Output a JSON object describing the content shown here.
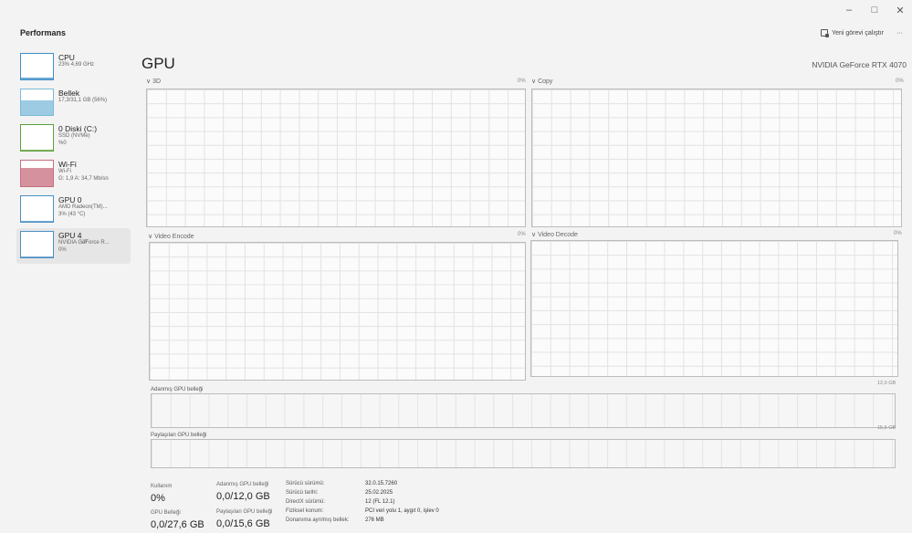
{
  "window": {
    "controls": [
      "–",
      "□",
      "✕"
    ]
  },
  "header": {
    "title": "Performans",
    "run_new_task": "Yeni görevi çalıştır",
    "more": "···"
  },
  "sidebar": {
    "items": [
      {
        "title": "CPU",
        "sub1": "23% 4,69 GHz",
        "sub2": "",
        "sub3": "",
        "color": "#3f8fc7",
        "fill_fraction": 0.06
      },
      {
        "title": "Bellek",
        "sub1": "17,3/31,1 GB (56%)",
        "sub2": "",
        "sub3": "",
        "color": "#7bbad9",
        "fill_fraction": 0.56
      },
      {
        "title": "0 Diski (C:)",
        "sub1": "SSD (NVMe)",
        "sub2": "%0",
        "sub3": "",
        "color": "#5d9e3a",
        "fill_fraction": 0.0
      },
      {
        "title": "Wi-Fi",
        "sub1": "Wi-Fi",
        "sub2": "G: 1,9 A: 34,7 Mb/sn",
        "sub3": "",
        "color": "#c76e7e",
        "fill_fraction": 0.7
      },
      {
        "title": "GPU 0",
        "sub1": "AMD Radeon(TM)...",
        "sub2": "3% (43 °C)",
        "sub3": "",
        "color": "#4a8fc2",
        "fill_fraction": 0.03
      },
      {
        "title": "GPU 4",
        "sub1": "NVIDIA GeForce R...",
        "sub2": "0%",
        "sub3": "",
        "color": "#4a8fc2",
        "fill_fraction": 0.0
      }
    ]
  },
  "main": {
    "title": "GPU",
    "model": "NVIDIA GeForce RTX 4070",
    "graphs": [
      {
        "label": "∨ 3D",
        "pct_left": "0%",
        "pct_right": ""
      },
      {
        "label": "∨ Copy",
        "pct_left": "",
        "pct_right": "0%"
      },
      {
        "label": "∨ Video Encode",
        "pct_left": "0%",
        "pct_right": ""
      },
      {
        "label": "∨ Video Decode",
        "pct_left": "",
        "pct_right": "0%"
      }
    ],
    "dedicated_memory": {
      "label": "Adanmış GPU belleği",
      "max": "12,0 GB"
    },
    "shared_memory": {
      "label": "Paylaşılan GPU belleği",
      "max": "15,6 GB"
    }
  },
  "stats": {
    "usage_label": "Kullanım",
    "usage_value": "0%",
    "dedicated_label": "Adanmış GPU belleği",
    "dedicated_value": "0,0/12,0 GB",
    "gpu_memory_label": "GPU Belleği",
    "gpu_memory_value": "0,0/27,6 GB",
    "shared_label": "Paylaşılan GPU belleği",
    "shared_value": "0,0/15,6 GB"
  },
  "info": [
    {
      "key": "Sürücü sürümü:",
      "value": "32.0.15.7260"
    },
    {
      "key": "Sürücü tarihi:",
      "value": "25.02.2025"
    },
    {
      "key": "DirectX sürümü:",
      "value": "12 (FL 12.1)"
    },
    {
      "key": "Fiziksel konum:",
      "value": "PCI veri yolu 1, aygıt 0, işlev 0"
    },
    {
      "key": "Donanıma ayrılmış bellek:",
      "value": "276 MB"
    }
  ]
}
